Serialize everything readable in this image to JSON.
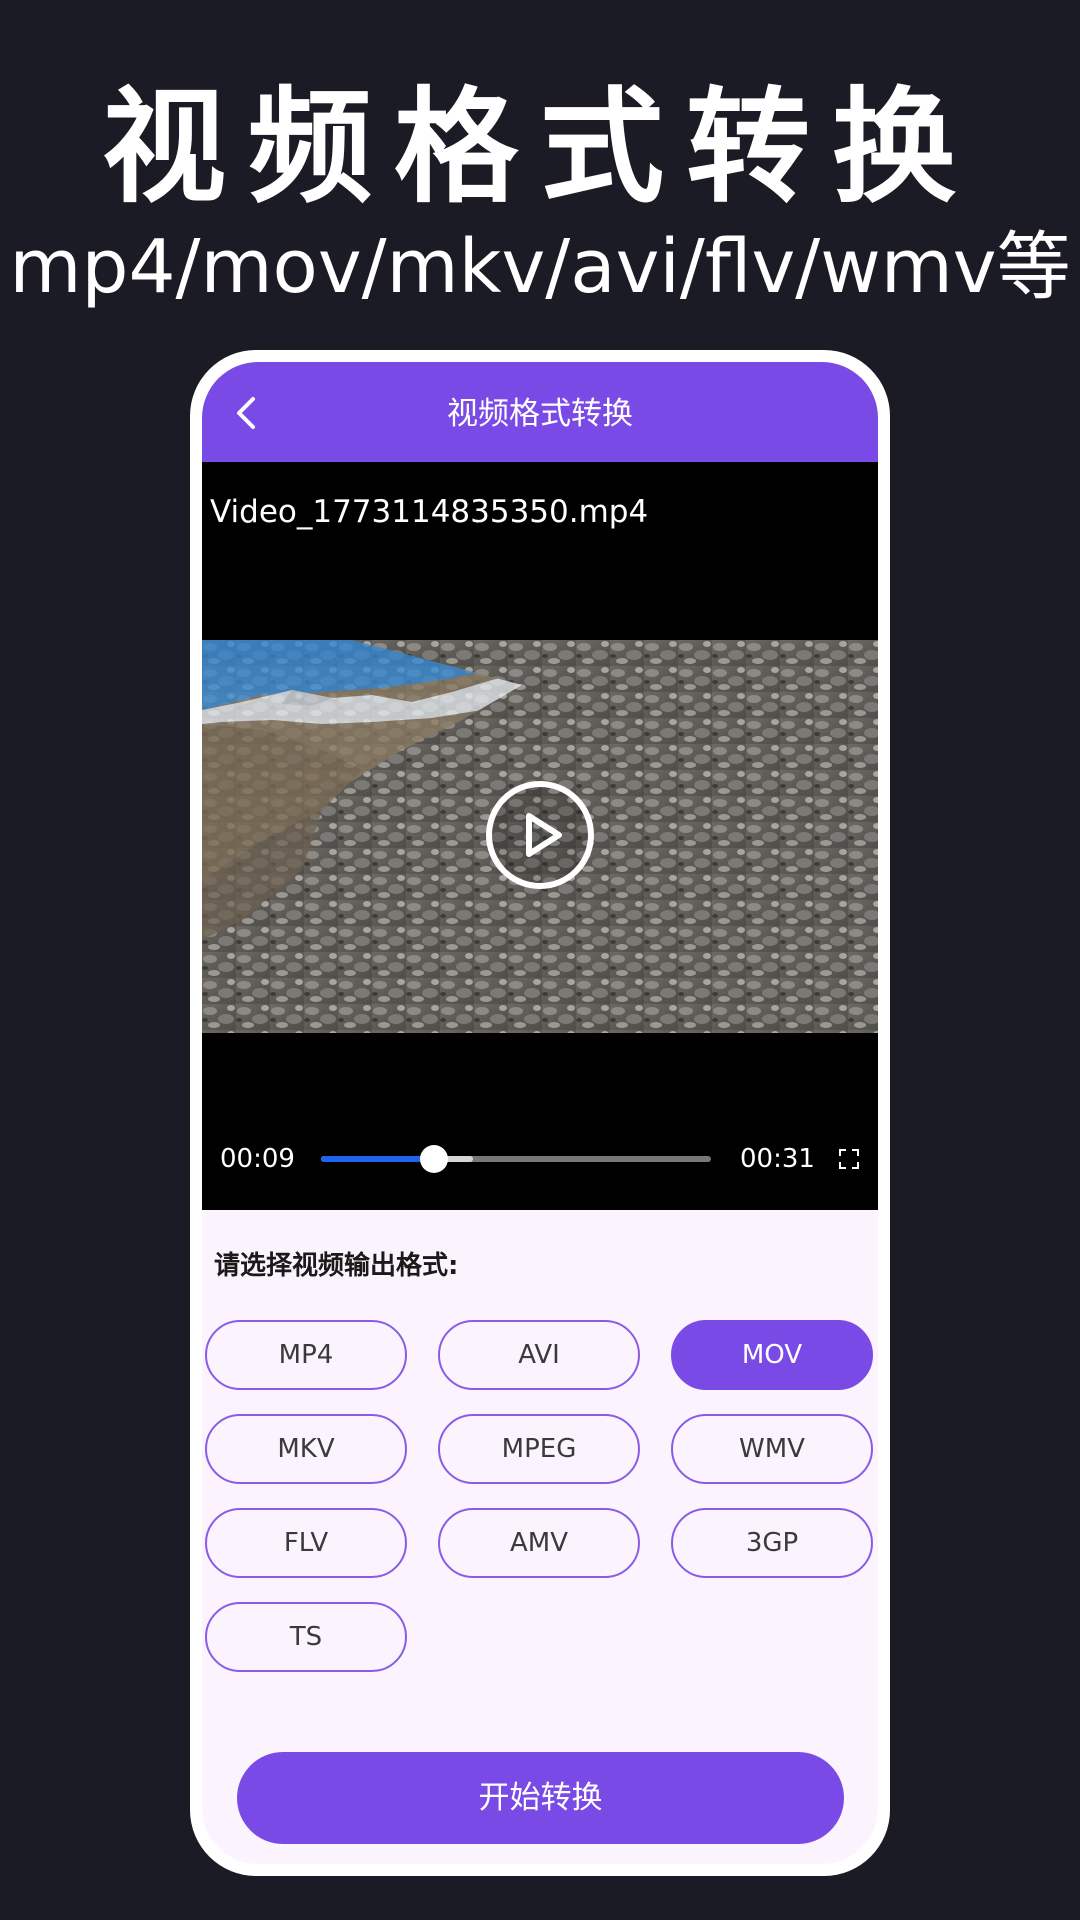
{
  "promo": {
    "title": "视频格式转换",
    "subtitle": "mp4/mov/mkv/avi/flv/wmv等"
  },
  "appbar": {
    "back_icon": "chevron-left-icon",
    "title": "视频格式转换"
  },
  "player": {
    "file_name": "Video_1773114835350.mp4",
    "current_time": "00:09",
    "total_time": "00:31",
    "progress": 0.29,
    "buffered": 0.39,
    "play_icon": "play-circle-icon",
    "fullscreen_icon": "fullscreen-icon"
  },
  "formats": {
    "label": "请选择视频输出格式:",
    "options": [
      "MP4",
      "AVI",
      "MOV",
      "MKV",
      "MPEG",
      "WMV",
      "FLV",
      "AMV",
      "3GP",
      "TS"
    ],
    "selected": "MOV"
  },
  "actions": {
    "start_label": "开始转换"
  },
  "colors": {
    "background": "#1b1b25",
    "accent": "#7a4ae6",
    "screen_bg": "#fbf3fe",
    "progress": "#1f63f0"
  }
}
